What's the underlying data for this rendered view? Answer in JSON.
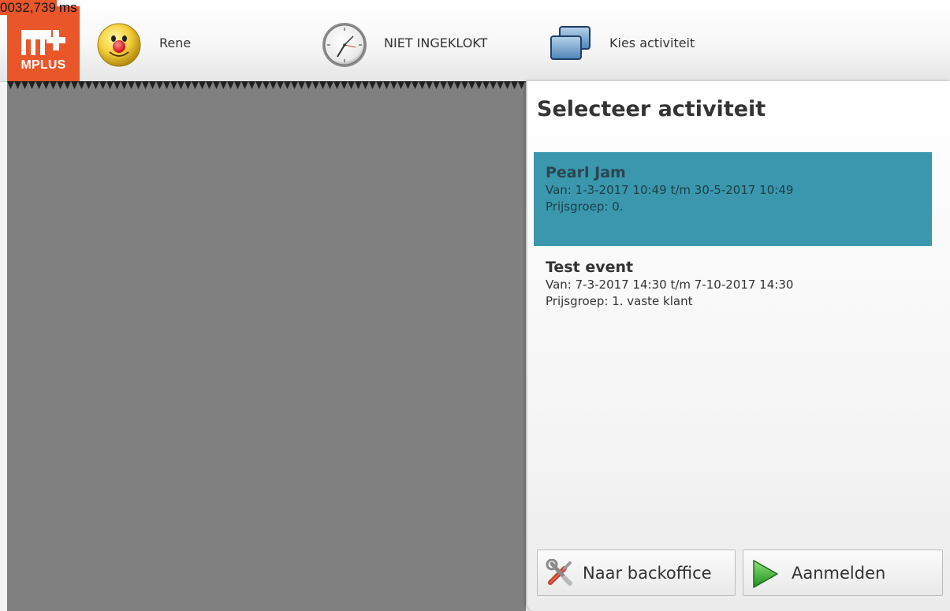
{
  "timer": {
    "value": "0032,739",
    "unit": "ms"
  },
  "header": {
    "logo_text": "MPLUS",
    "user_name": "Rene",
    "clock_status": "NIET INGEKLOKT",
    "activity_label": "Kies activiteit"
  },
  "panel": {
    "title": "Selecteer activiteit",
    "activities": [
      {
        "name": "Pearl Jam",
        "period": "Van: 1-3-2017 10:49 t/m 30-5-2017 10:49",
        "price_group": "Prijsgroep: 0.",
        "selected": true
      },
      {
        "name": "Test event",
        "period": "Van: 7-3-2017 14:30 t/m 7-10-2017 14:30",
        "price_group": "Prijsgroep: 1. vaste klant",
        "selected": false
      }
    ],
    "buttons": {
      "backoffice": "Naar backoffice",
      "login": "Aanmelden"
    }
  },
  "colors": {
    "brand": "#e8562a",
    "selected_item": "#3a97ad",
    "left_area": "#808080"
  },
  "icons": {
    "user": "smiley-face-icon",
    "clock": "clock-icon",
    "activity": "stacked-windows-icon",
    "backoffice": "tools-icon",
    "login": "play-arrow-icon"
  }
}
